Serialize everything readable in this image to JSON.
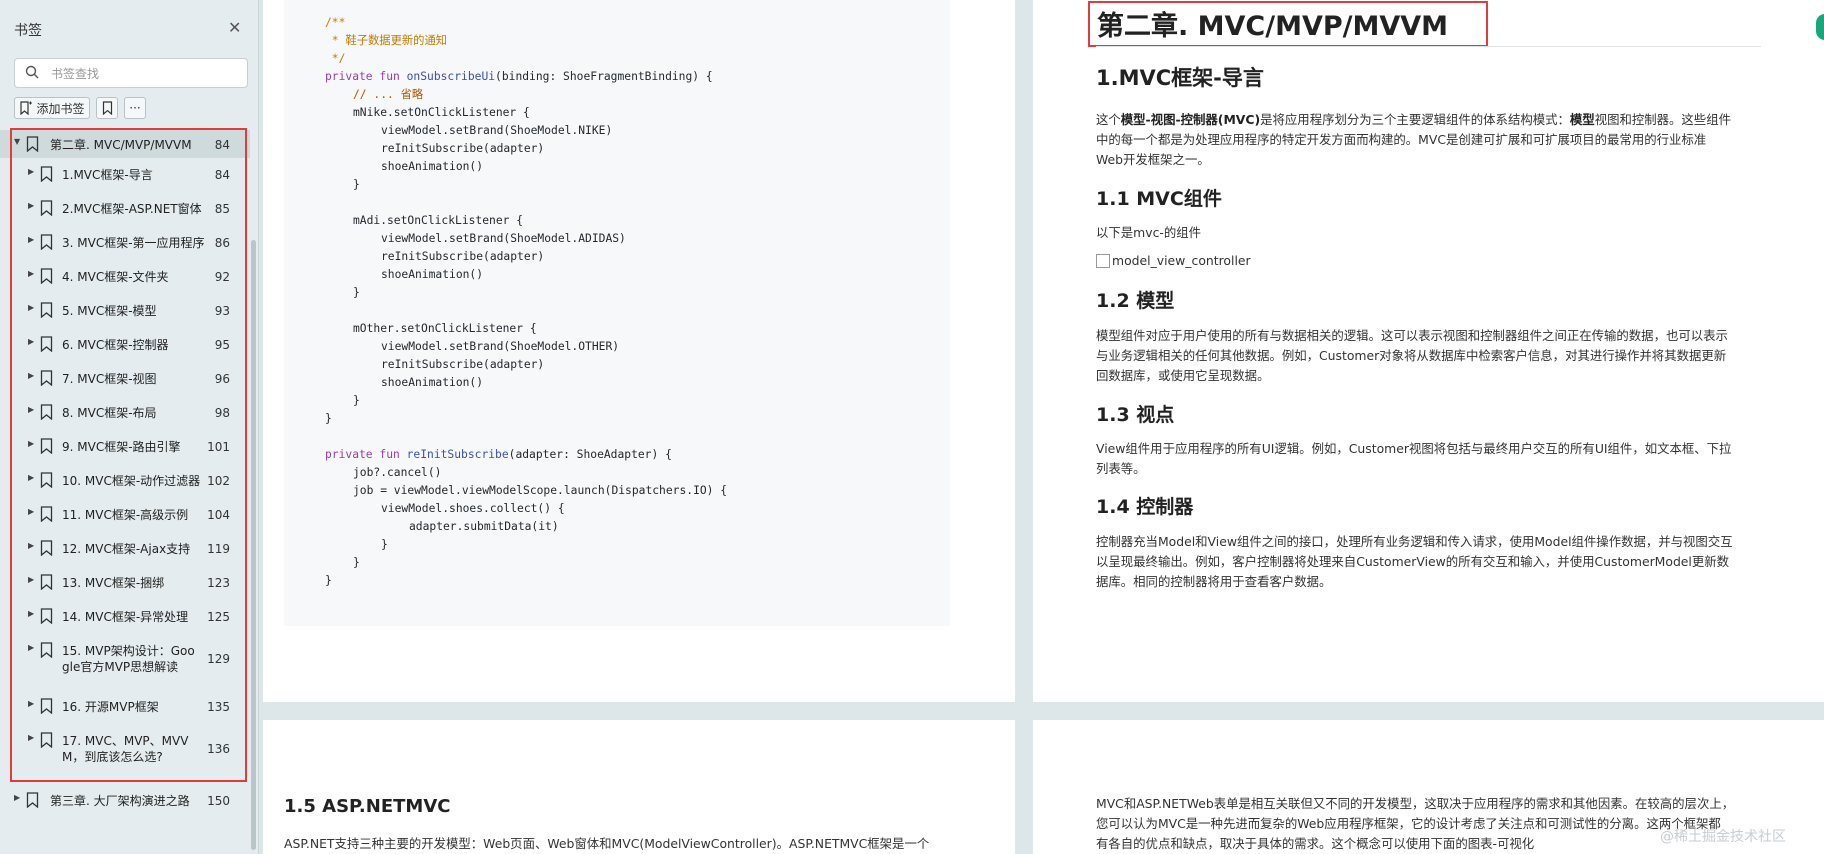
{
  "sidebar": {
    "title": "书签",
    "search_placeholder": "书签查找",
    "add_bookmark_label": "添加书签",
    "items": [
      {
        "label": "第二章. MVC/MVP/MVVM",
        "page": "84",
        "level": 0,
        "expanded": true,
        "selected": true
      },
      {
        "label": "1.MVC框架-导言",
        "page": "84",
        "level": 1
      },
      {
        "label": "2.MVC框架-ASP.NET窗体",
        "page": "85",
        "level": 1
      },
      {
        "label": "3. MVC框架-第一应用程序",
        "page": "86",
        "level": 1
      },
      {
        "label": "4. MVC框架-文件夹",
        "page": "92",
        "level": 1
      },
      {
        "label": "5. MVC框架-模型",
        "page": "93",
        "level": 1
      },
      {
        "label": "6. MVC框架-控制器",
        "page": "95",
        "level": 1
      },
      {
        "label": "7. MVC框架-视图",
        "page": "96",
        "level": 1
      },
      {
        "label": "8. MVC框架-布局",
        "page": "98",
        "level": 1
      },
      {
        "label": "9. MVC框架-路由引擎",
        "page": "101",
        "level": 1
      },
      {
        "label": "10. MVC框架-动作过滤器",
        "page": "102",
        "level": 1
      },
      {
        "label": "11. MVC框架-高级示例",
        "page": "104",
        "level": 1
      },
      {
        "label": "12. MVC框架-Ajax支持",
        "page": "119",
        "level": 1
      },
      {
        "label": "13. MVC框架-捆绑",
        "page": "123",
        "level": 1
      },
      {
        "label": "14. MVC框架-异常处理",
        "page": "125",
        "level": 1
      },
      {
        "label": "15. MVP架构设计：Goo",
        "label2": "gle官方MVP思想解读",
        "page": "129",
        "level": 1
      },
      {
        "label": "16. 开源MVP框架",
        "page": "135",
        "level": 1
      },
      {
        "label": "17. MVC、MVP、MVV",
        "label2": "M，到底该怎么选?",
        "page": "136",
        "level": 1
      },
      {
        "label": "第三章. 大厂架构演进之路",
        "page": "150",
        "level": 0
      }
    ]
  },
  "code_lines": [
    {
      "indent": 0,
      "parts": [
        {
          "c": "cm",
          "t": "/**"
        }
      ]
    },
    {
      "indent": 0,
      "parts": [
        {
          "c": "cm",
          "t": " * 鞋子数据更新的通知"
        }
      ]
    },
    {
      "indent": 0,
      "parts": [
        {
          "c": "cm",
          "t": " */"
        }
      ]
    },
    {
      "indent": 0,
      "parts": [
        {
          "c": "kw",
          "t": "private fun "
        },
        {
          "c": "fn",
          "t": "onSubscribeUi"
        },
        {
          "c": "",
          "t": "(binding: ShoeFragmentBinding) {"
        }
      ]
    },
    {
      "indent": 1,
      "parts": [
        {
          "c": "cmk",
          "t": "// ... 省略"
        }
      ]
    },
    {
      "indent": 1,
      "parts": [
        {
          "c": "",
          "t": "mNike.setOnClickListener {"
        }
      ]
    },
    {
      "indent": 2,
      "parts": [
        {
          "c": "",
          "t": "viewModel.setBrand(ShoeModel.NIKE)"
        }
      ]
    },
    {
      "indent": 2,
      "parts": [
        {
          "c": "",
          "t": "reInitSubscribe(adapter)"
        }
      ]
    },
    {
      "indent": 2,
      "parts": [
        {
          "c": "",
          "t": "shoeAnimation()"
        }
      ]
    },
    {
      "indent": 1,
      "parts": [
        {
          "c": "",
          "t": "}"
        }
      ]
    },
    {
      "indent": 0,
      "parts": [
        {
          "c": "",
          "t": ""
        }
      ]
    },
    {
      "indent": 1,
      "parts": [
        {
          "c": "",
          "t": "mAdi.setOnClickListener {"
        }
      ]
    },
    {
      "indent": 2,
      "parts": [
        {
          "c": "",
          "t": "viewModel.setBrand(ShoeModel.ADIDAS)"
        }
      ]
    },
    {
      "indent": 2,
      "parts": [
        {
          "c": "",
          "t": "reInitSubscribe(adapter)"
        }
      ]
    },
    {
      "indent": 2,
      "parts": [
        {
          "c": "",
          "t": "shoeAnimation()"
        }
      ]
    },
    {
      "indent": 1,
      "parts": [
        {
          "c": "",
          "t": "}"
        }
      ]
    },
    {
      "indent": 0,
      "parts": [
        {
          "c": "",
          "t": ""
        }
      ]
    },
    {
      "indent": 1,
      "parts": [
        {
          "c": "",
          "t": "mOther.setOnClickListener {"
        }
      ]
    },
    {
      "indent": 2,
      "parts": [
        {
          "c": "",
          "t": "viewModel.setBrand(ShoeModel.OTHER)"
        }
      ]
    },
    {
      "indent": 2,
      "parts": [
        {
          "c": "",
          "t": "reInitSubscribe(adapter)"
        }
      ]
    },
    {
      "indent": 2,
      "parts": [
        {
          "c": "",
          "t": "shoeAnimation()"
        }
      ]
    },
    {
      "indent": 1,
      "parts": [
        {
          "c": "",
          "t": "}"
        }
      ]
    },
    {
      "indent": 0,
      "parts": [
        {
          "c": "",
          "t": "}"
        }
      ]
    },
    {
      "indent": 0,
      "parts": [
        {
          "c": "",
          "t": ""
        }
      ]
    },
    {
      "indent": 0,
      "parts": [
        {
          "c": "kw",
          "t": "private fun "
        },
        {
          "c": "fn",
          "t": "reInitSubscribe"
        },
        {
          "c": "",
          "t": "(adapter: ShoeAdapter) {"
        }
      ]
    },
    {
      "indent": 1,
      "parts": [
        {
          "c": "",
          "t": "job?.cancel()"
        }
      ]
    },
    {
      "indent": 1,
      "parts": [
        {
          "c": "",
          "t": "job = viewModel.viewModelScope.launch(Dispatchers.IO) {"
        }
      ]
    },
    {
      "indent": 2,
      "parts": [
        {
          "c": "",
          "t": "viewModel.shoes.collect() {"
        }
      ]
    },
    {
      "indent": 3,
      "parts": [
        {
          "c": "",
          "t": "adapter.submitData(it)"
        }
      ]
    },
    {
      "indent": 2,
      "parts": [
        {
          "c": "",
          "t": "}"
        }
      ]
    },
    {
      "indent": 1,
      "parts": [
        {
          "c": "",
          "t": "}"
        }
      ]
    },
    {
      "indent": 0,
      "parts": [
        {
          "c": "",
          "t": "}"
        }
      ]
    }
  ],
  "doc": {
    "chapter_title": "第二章. MVC/MVP/MVVM",
    "h_intro": "1.MVC框架-导言",
    "intro_p1_a": "这个",
    "intro_p1_b": "模型-视图-控制器(MVC)",
    "intro_p1_c": "是将应用程序划分为三个主要逻辑组件的体系结构模式：",
    "intro_p1_d": "模型",
    "intro_p1_e": "视图和控制器。这些组件",
    "intro_p1_line2": "中的每一个都是为处理应用程序的特定开发方面而构建的。MVC是创建可扩展和可扩展项目的最常用的行业标准",
    "intro_p1_line3": "Web开发框架之一。",
    "h_components": "1.1 MVC组件",
    "components_p": "以下是mvc-的组件",
    "img_alt": "model_view_controller",
    "h_model": "1.2 模型",
    "model_p1": "模型组件对应于用户使用的所有与数据相关的逻辑。这可以表示视图和控制器组件之间正在传输的数据，也可以表示",
    "model_p2": "与业务逻辑相关的任何其他数据。例如，Customer对象将从数据库中检索客户信息，对其进行操作并将其数据更新",
    "model_p3": "回数据库，或使用它呈现数据。",
    "h_view": "1.3 视点",
    "view_p1": "View组件用于应用程序的所有UI逻辑。例如，Customer视图将包括与最终用户交互的所有UI组件，如文本框、下拉",
    "view_p2": "列表等。",
    "h_controller": "1.4 控制器",
    "ctrl_p1": "控制器充当Model和View组件之间的接口，处理所有业务逻辑和传入请求，使用Model组件操作数据，并与视图交互",
    "ctrl_p2": "以呈现最终输出。例如，客户控制器将处理来自CustomerView的所有交互和输入，并使用CustomerModel更新数",
    "ctrl_p3": "据库。相同的控制器将用于查看客户数据。",
    "h_aspnet": "1.5 ASP.NETMVC",
    "aspnet_p1": "ASP.NET支持三种主要的开发模型：Web页面、Web窗体和MVC(ModelViewController)。ASP.NETMVC框架是一个",
    "r2_p1": "MVC和ASP.NETWeb表单是相互关联但又不同的开发模型，这取决于应用程序的需求和其他因素。在较高的层次上，",
    "r2_p2": "您可以认为MVC是一种先进而复杂的Web应用程序框架，它的设计考虑了关注点和可测试性的分离。这两个框架都",
    "r2_p3": "有各自的优点和缺点，取决于具体的需求。这个概念可以使用下面的图表-可视化"
  },
  "watermark": "@稀土掘金技术社区",
  "colors": {
    "highlight_box": "#e23b3b",
    "selected_row": "#cfdadd",
    "keyword": "#9d3bb2",
    "function": "#3a4fb8",
    "comment": "#c27b00"
  }
}
